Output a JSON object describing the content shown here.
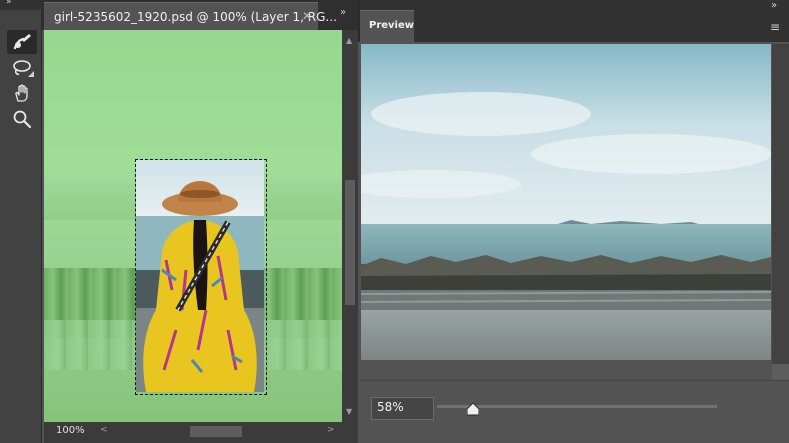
{
  "document": {
    "tab_title": "girl-5235602_1920.psd @ 100% (Layer 1, RG...",
    "zoom_status": "100%"
  },
  "toolbar": {
    "collapse_glyph": "»",
    "tools": [
      {
        "name": "quick-selection",
        "icon": "brush-icon"
      },
      {
        "name": "lasso",
        "icon": "lasso-icon"
      },
      {
        "name": "hand",
        "icon": "hand-icon"
      },
      {
        "name": "zoom",
        "icon": "magnifier-icon"
      }
    ]
  },
  "preview": {
    "tab_label": "Preview",
    "zoom_value": "58%",
    "zoom_fraction": 0.58,
    "menu_glyph": "≡",
    "collapse_glyph": "»"
  },
  "colors": {
    "panel_bg": "#535353",
    "dark_bar": "#323232",
    "overlay_green": "#96d88f"
  }
}
